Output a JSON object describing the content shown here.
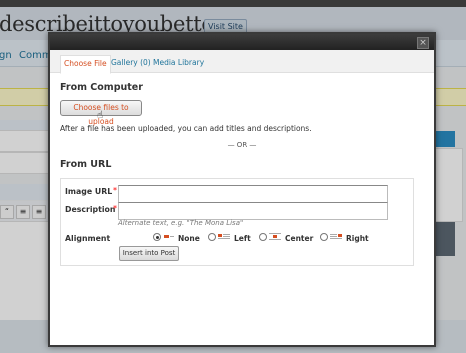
{
  "background": {
    "site_title": "describeittoyoubetter.",
    "visit_site_label": "Visit Site",
    "nav_items": [
      "gn",
      "Comm"
    ]
  },
  "modal": {
    "tabs": [
      {
        "label": "Choose File",
        "active": true
      },
      {
        "label": "Gallery (0)",
        "active": false
      },
      {
        "label": "Media Library",
        "active": false
      }
    ],
    "from_computer": {
      "heading": "From Computer",
      "upload_button": "Choose files to upload",
      "hint": "After a file has been uploaded, you can add titles and descriptions."
    },
    "or_divider": "— OR —",
    "from_url": {
      "heading": "From URL",
      "image_url_label": "Image URL",
      "image_url_value": "",
      "description_label": "Description",
      "description_value": "",
      "required_mark": "*",
      "alt_help": "Alternate text, e.g. \"The Mona Lisa\"",
      "alignment_label": "Alignment",
      "alignment_options": [
        {
          "label": "None",
          "selected": true
        },
        {
          "label": "Left",
          "selected": false
        },
        {
          "label": "Center",
          "selected": false
        },
        {
          "label": "Right",
          "selected": false
        }
      ],
      "insert_button": "Insert into Post"
    },
    "close_icon": "×"
  },
  "colors": {
    "link": "#21759b",
    "accent": "#d54e21",
    "required": "#ff0000"
  }
}
